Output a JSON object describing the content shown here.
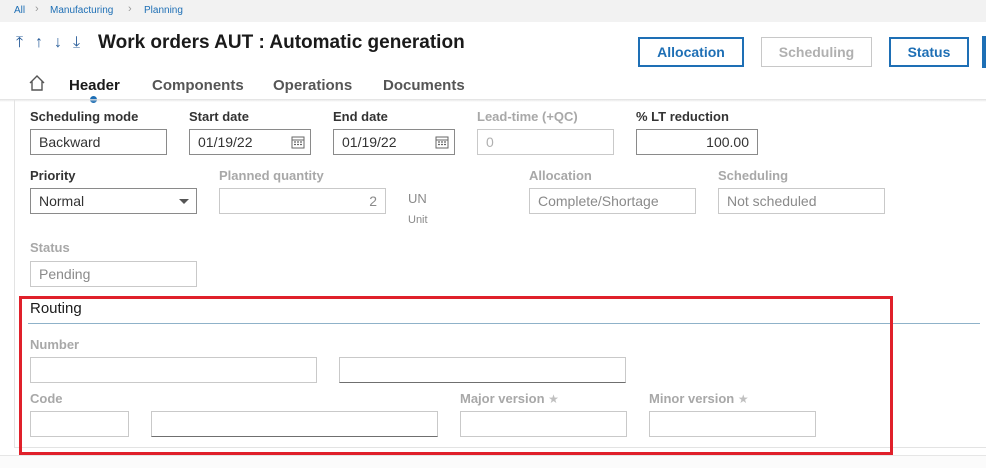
{
  "breadcrumb": {
    "items": [
      "All",
      "Manufacturing",
      "Planning"
    ]
  },
  "header": {
    "title": "Work orders AUT : Automatic generation",
    "buttons": {
      "allocation": "Allocation",
      "scheduling": "Scheduling",
      "status": "Status"
    }
  },
  "nav_icons": [
    "first-record-icon",
    "previous-record-icon",
    "next-record-icon",
    "last-record-icon"
  ],
  "tabs": [
    "Header",
    "Components",
    "Operations",
    "Documents"
  ],
  "fields": {
    "scheduling_mode": {
      "label": "Scheduling mode",
      "value": "Backward"
    },
    "start_date": {
      "label": "Start date",
      "value": "01/19/22"
    },
    "end_date": {
      "label": "End date",
      "value": "01/19/22"
    },
    "lead_time": {
      "label": "Lead-time (+QC)",
      "value": "0"
    },
    "lt_reduction": {
      "label": "% LT reduction",
      "value": "100.00"
    },
    "priority": {
      "label": "Priority",
      "value": "Normal"
    },
    "planned_quantity": {
      "label": "Planned quantity",
      "value": "2",
      "unit": "UN",
      "unit_caption": "Unit"
    },
    "allocation": {
      "label": "Allocation",
      "value": "Complete/Shortage"
    },
    "scheduling": {
      "label": "Scheduling",
      "value": "Not scheduled"
    },
    "status": {
      "label": "Status",
      "value": "Pending"
    }
  },
  "routing": {
    "section_title": "Routing",
    "number_label": "Number",
    "code_label": "Code",
    "major_version_label": "Major version",
    "minor_version_label": "Minor version"
  },
  "colors": {
    "accent": "#1e6fb5",
    "highlight": "#e0202a"
  }
}
